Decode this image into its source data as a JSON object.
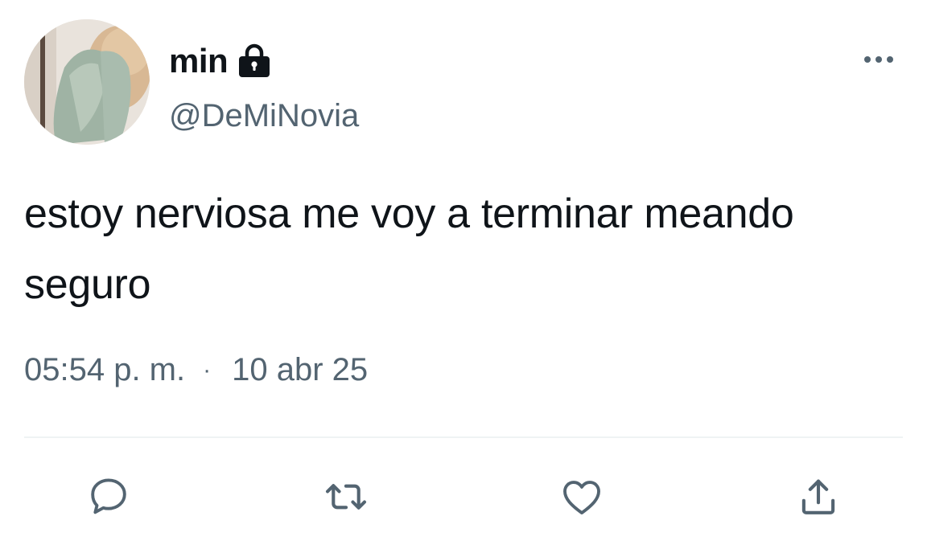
{
  "tweet": {
    "display_name": "min",
    "handle": "@DeMiNovia",
    "text": "estoy nerviosa me voy a terminar meando seguro",
    "time": "05:54 p. m.",
    "separator": "·",
    "date": "10 abr 25"
  },
  "icons": {
    "lock": "lock-icon",
    "more": "more-horizontal-icon",
    "reply": "reply-bubble-icon",
    "retweet": "retweet-icon",
    "like": "heart-icon",
    "share": "share-upload-icon"
  },
  "colors": {
    "text_primary": "#0f1419",
    "text_secondary": "#536471",
    "divider": "#eff3f4"
  }
}
